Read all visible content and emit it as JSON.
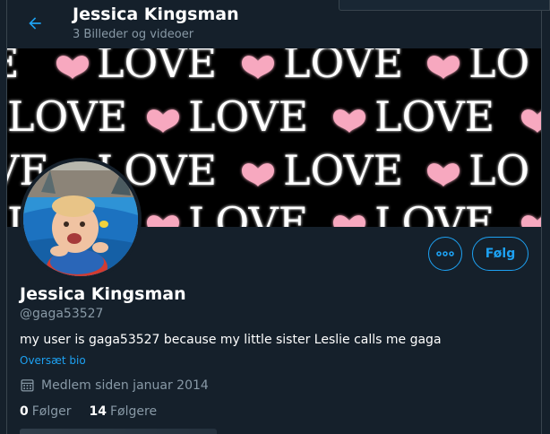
{
  "header": {
    "name": "Jessica Kingsman",
    "subtitle": "3 Billeder og videoer",
    "back_icon": "arrow-left-icon"
  },
  "banner": {
    "word": "LOVE",
    "heart_color": "#f7a8bf",
    "text_color": "#ffffff",
    "background": "#000000"
  },
  "profile": {
    "name": "Jessica Kingsman",
    "handle": "@gaga53527",
    "bio": "my user is gaga53527 because my little sister Leslie calls me gaga",
    "translate_label": "Oversæt bio",
    "joined": "Medlem siden januar 2014",
    "following_count": "0",
    "following_label": "Følger",
    "followers_count": "14",
    "followers_label": "Følgere"
  },
  "actions": {
    "more_icon": "more-horizontal-icon",
    "follow_label": "Følg"
  },
  "colors": {
    "accent": "#1da1f2",
    "background": "#15202b",
    "secondary_text": "#8899a6",
    "border": "#38444d"
  }
}
